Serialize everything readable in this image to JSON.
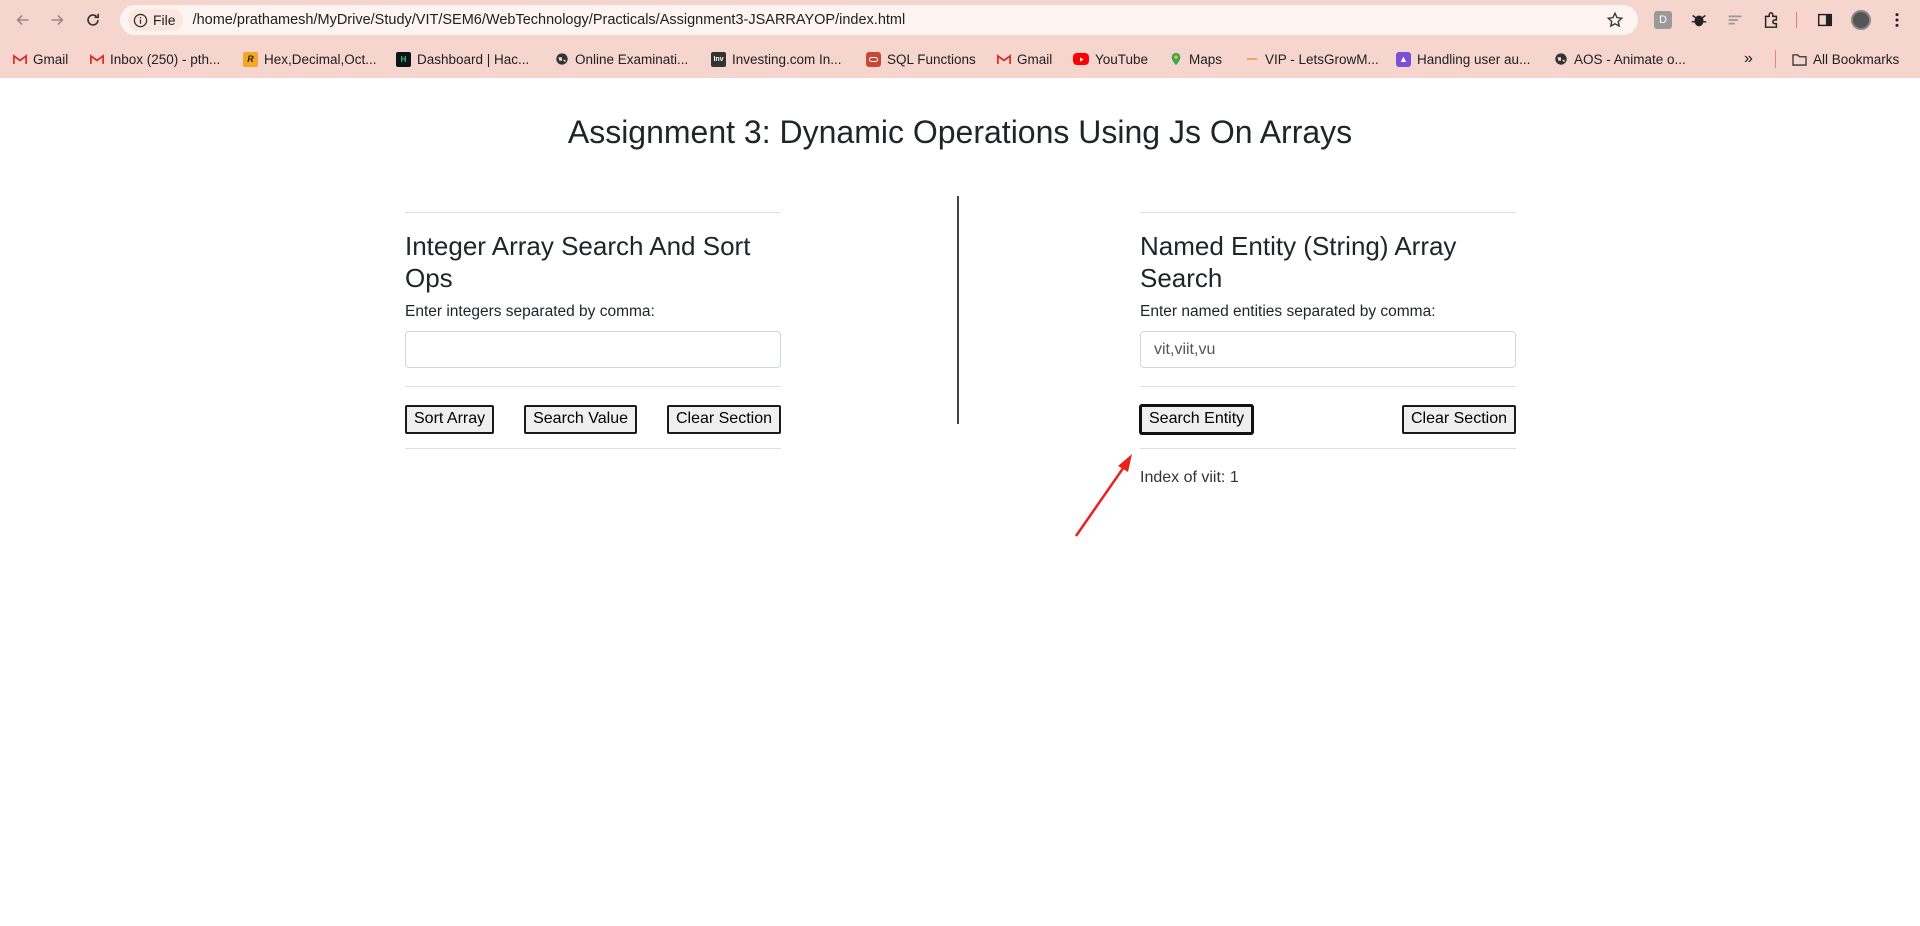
{
  "browser": {
    "url_scheme": "File",
    "url": "/home/prathamesh/MyDrive/Study/VIT/SEM6/WebTechnology/Practicals/Assignment3-JSARRAYOP/index.html",
    "bookmarks": [
      {
        "label": "Gmail",
        "icon": "gmail-icon"
      },
      {
        "label": "Inbox (250) - pth...",
        "icon": "gmail-icon"
      },
      {
        "label": "Hex,Decimal,Oct...",
        "icon": "r-icon"
      },
      {
        "label": "Dashboard | Hac...",
        "icon": "hackerrank-icon"
      },
      {
        "label": "Online Examinati...",
        "icon": "globe-icon"
      },
      {
        "label": "Investing.com In...",
        "icon": "investing-icon"
      },
      {
        "label": "SQL Functions",
        "icon": "oracle-icon"
      },
      {
        "label": "Gmail",
        "icon": "gmail-icon"
      },
      {
        "label": "YouTube",
        "icon": "youtube-icon"
      },
      {
        "label": "Maps",
        "icon": "maps-icon"
      },
      {
        "label": "VIP - LetsGrowM...",
        "icon": "dash-icon"
      },
      {
        "label": "Handling user au...",
        "icon": "purple-icon"
      },
      {
        "label": "AOS - Animate o...",
        "icon": "globe-icon"
      }
    ],
    "all_bookmarks": "All Bookmarks",
    "colors": {
      "chrome_bg": "#f5d5cd",
      "omnibox_bg": "#fdf3f0"
    }
  },
  "page": {
    "title": "Assignment 3: Dynamic Operations Using Js On Arrays",
    "left": {
      "title": "Integer Array Search And Sort Ops",
      "label": "Enter integers separated by comma:",
      "input_value": "",
      "buttons": {
        "sort": "Sort Array",
        "search": "Search Value",
        "clear": "Clear Section"
      }
    },
    "right": {
      "title": "Named Entity (String) Array Search",
      "label": "Enter named entities separated by comma:",
      "input_value": "vit,viit,vu",
      "buttons": {
        "search": "Search Entity",
        "clear": "Clear Section"
      },
      "result": "Index of viit: 1"
    },
    "annotation_color": "#e8231f"
  }
}
